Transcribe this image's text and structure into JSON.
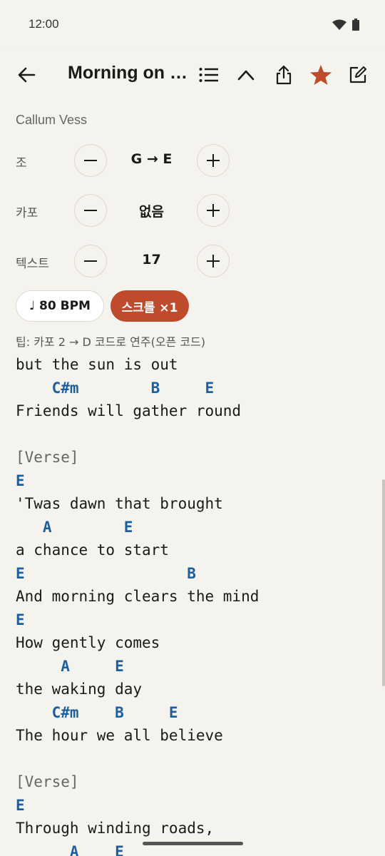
{
  "status": {
    "time": "12:00"
  },
  "toolbar": {
    "title": "Morning on the Road"
  },
  "artist": "Callum Vess",
  "controls": {
    "key": {
      "label": "조",
      "value": "G → E"
    },
    "capo": {
      "label": "카포",
      "value": "없음"
    },
    "text": {
      "label": "텍스트",
      "value": "17"
    }
  },
  "bpm_label": "80 BPM",
  "scroll_label": "스크롤 ×1",
  "tip": "팁: 카포 2 → D 코드로 연주(오픈 코드)",
  "colors": {
    "accent": "#bf4a2c",
    "chord": "#1d5f9c",
    "background": "#f5f3ee"
  },
  "song_lines": [
    {
      "type": "lyric",
      "text": "but the sun is out"
    },
    {
      "type": "chord",
      "text": "    C#m        B     E"
    },
    {
      "type": "lyric",
      "text": "Friends will gather round"
    },
    {
      "type": "blank",
      "text": ""
    },
    {
      "type": "section",
      "text": "[Verse]"
    },
    {
      "type": "chord",
      "text": "E"
    },
    {
      "type": "lyric",
      "text": "'Twas dawn that brought"
    },
    {
      "type": "chord",
      "text": "   A        E"
    },
    {
      "type": "lyric",
      "text": "a chance to start"
    },
    {
      "type": "chord",
      "text": "E                  B"
    },
    {
      "type": "lyric",
      "text": "And morning clears the mind"
    },
    {
      "type": "chord",
      "text": "E"
    },
    {
      "type": "lyric",
      "text": "How gently comes"
    },
    {
      "type": "chord",
      "text": "     A     E"
    },
    {
      "type": "lyric",
      "text": "the waking day"
    },
    {
      "type": "chord",
      "text": "    C#m    B     E"
    },
    {
      "type": "lyric",
      "text": "The hour we all believe"
    },
    {
      "type": "blank",
      "text": ""
    },
    {
      "type": "section",
      "text": "[Verse]"
    },
    {
      "type": "chord",
      "text": "E"
    },
    {
      "type": "lyric",
      "text": "Through winding roads,"
    },
    {
      "type": "chord",
      "text": "      A    E"
    }
  ]
}
